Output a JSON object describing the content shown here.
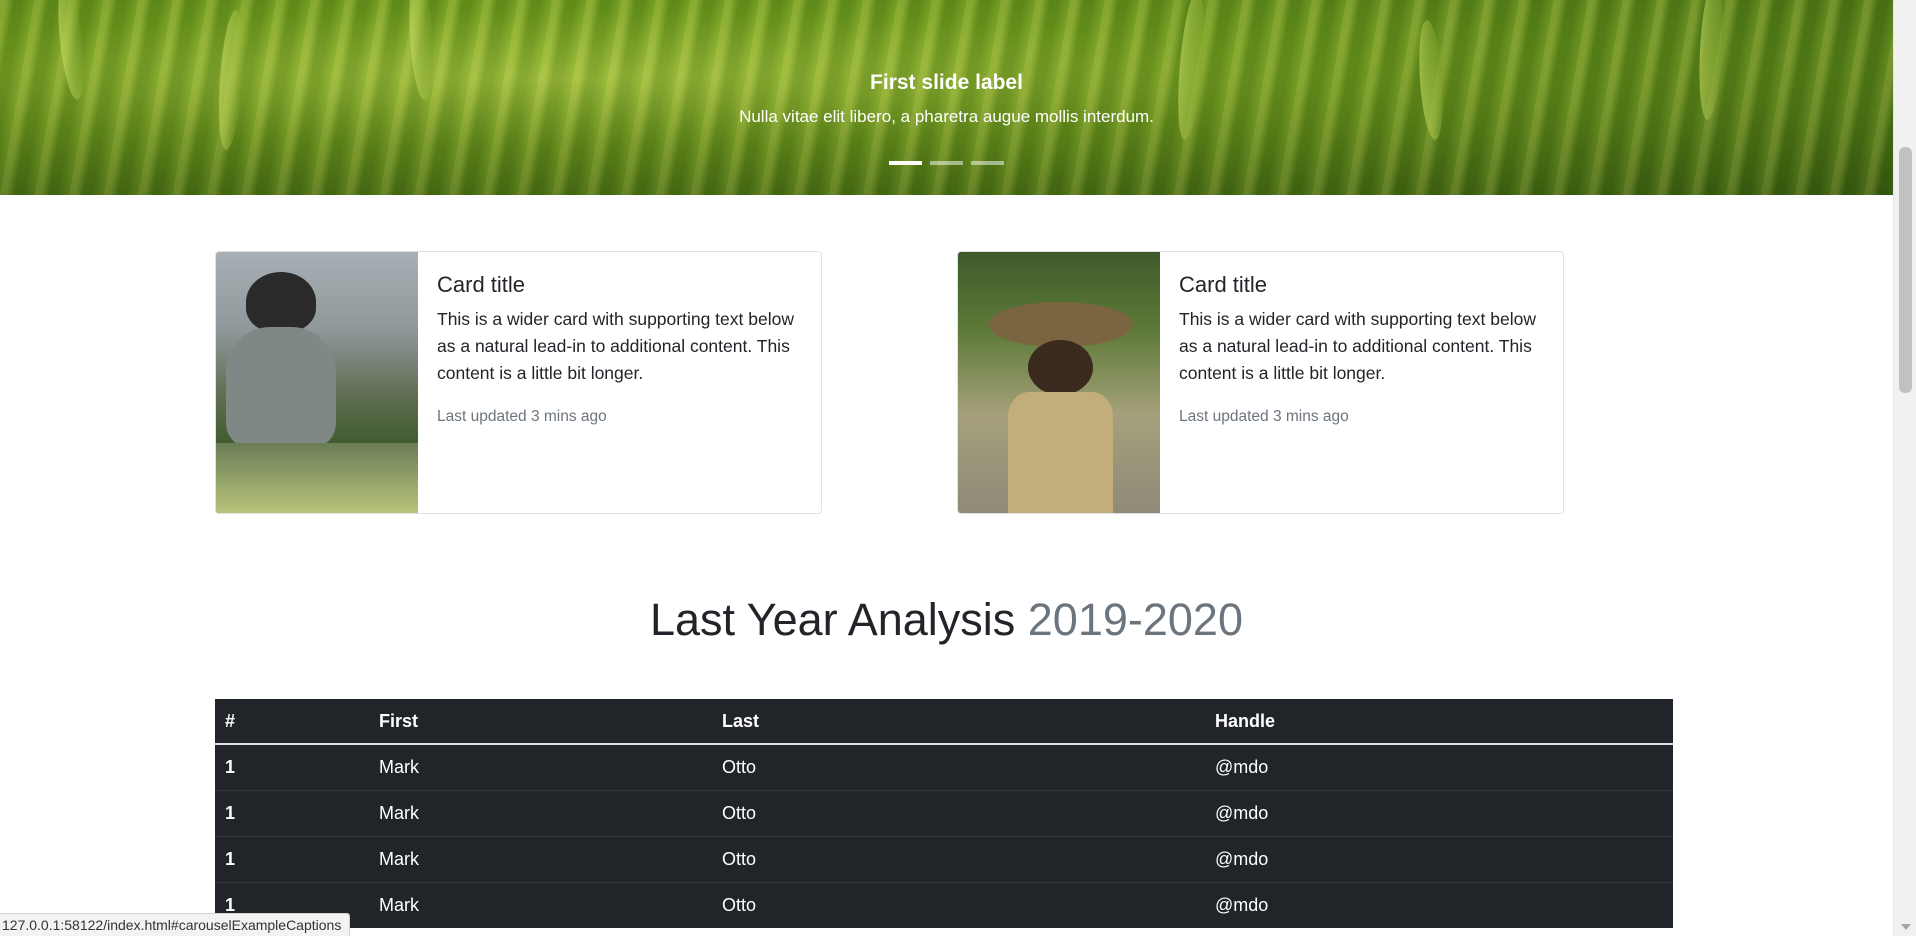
{
  "carousel": {
    "caption_title": "First slide label",
    "caption_text": "Nulla vitae elit libero, a pharetra augue mollis interdum.",
    "indicators": [
      "slide-1",
      "slide-2",
      "slide-3"
    ],
    "active_index": 0
  },
  "cards": [
    {
      "title": "Card title",
      "text": "This is a wider card with supporting text below as a natural lead-in to additional content. This content is a little bit longer.",
      "updated": "Last updated 3 mins ago"
    },
    {
      "title": "Card title",
      "text": "This is a wider card with supporting text below as a natural lead-in to additional content. This content is a little bit longer.",
      "updated": "Last updated 3 mins ago"
    }
  ],
  "analysis": {
    "title": "Last Year Analysis",
    "years": "2019-2020"
  },
  "table": {
    "headers": [
      "#",
      "First",
      "Last",
      "Handle"
    ],
    "rows": [
      [
        "1",
        "Mark",
        "Otto",
        "@mdo"
      ],
      [
        "1",
        "Mark",
        "Otto",
        "@mdo"
      ],
      [
        "1",
        "Mark",
        "Otto",
        "@mdo"
      ],
      [
        "1",
        "Mark",
        "Otto",
        "@mdo"
      ]
    ]
  },
  "statusbar": {
    "url": "127.0.0.1:58122/index.html#carouselExampleCaptions"
  },
  "colors": {
    "table_bg": "#212529",
    "muted": "#6c757d"
  }
}
